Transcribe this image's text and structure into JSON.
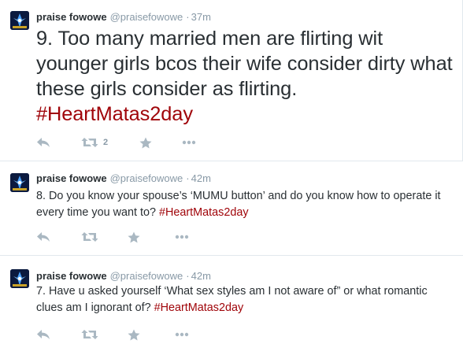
{
  "colors": {
    "hashtag": "#a0050a",
    "meta": "#8899a6",
    "text": "#292f33",
    "border": "#e1e8ed"
  },
  "tweets": [
    {
      "name": "praise fowowe",
      "handle": "@praisefowowe",
      "separator": "·",
      "time": "37m",
      "text": "9. Too many married men are flirting wit younger girls bcos their wife consider dirty what these girls consider as flirting. ",
      "hashtag": "#HeartMatas2day",
      "retweet_count": "2",
      "icons": [
        "reply-icon",
        "retweet-icon",
        "favorite-icon",
        "more-icon"
      ]
    },
    {
      "name": "praise fowowe",
      "handle": "@praisefowowe",
      "separator": "·",
      "time": "42m",
      "text": "8. Do you know your spouse’s ‘MUMU button’ and do you know how to operate it every time you want to? ",
      "hashtag": "#HeartMatas2day",
      "retweet_count": "",
      "icons": [
        "reply-icon",
        "retweet-icon",
        "favorite-icon",
        "more-icon"
      ]
    },
    {
      "name": "praise fowowe",
      "handle": "@praisefowowe",
      "separator": "·",
      "time": "42m",
      "text": "7. Have u asked yourself ‘What sex styles am I not aware of” or what romantic clues am I ignorant of? ",
      "hashtag": "#HeartMatas2day",
      "retweet_count": "",
      "icons": [
        "reply-icon",
        "retweet-icon",
        "favorite-icon",
        "more-icon"
      ]
    }
  ]
}
